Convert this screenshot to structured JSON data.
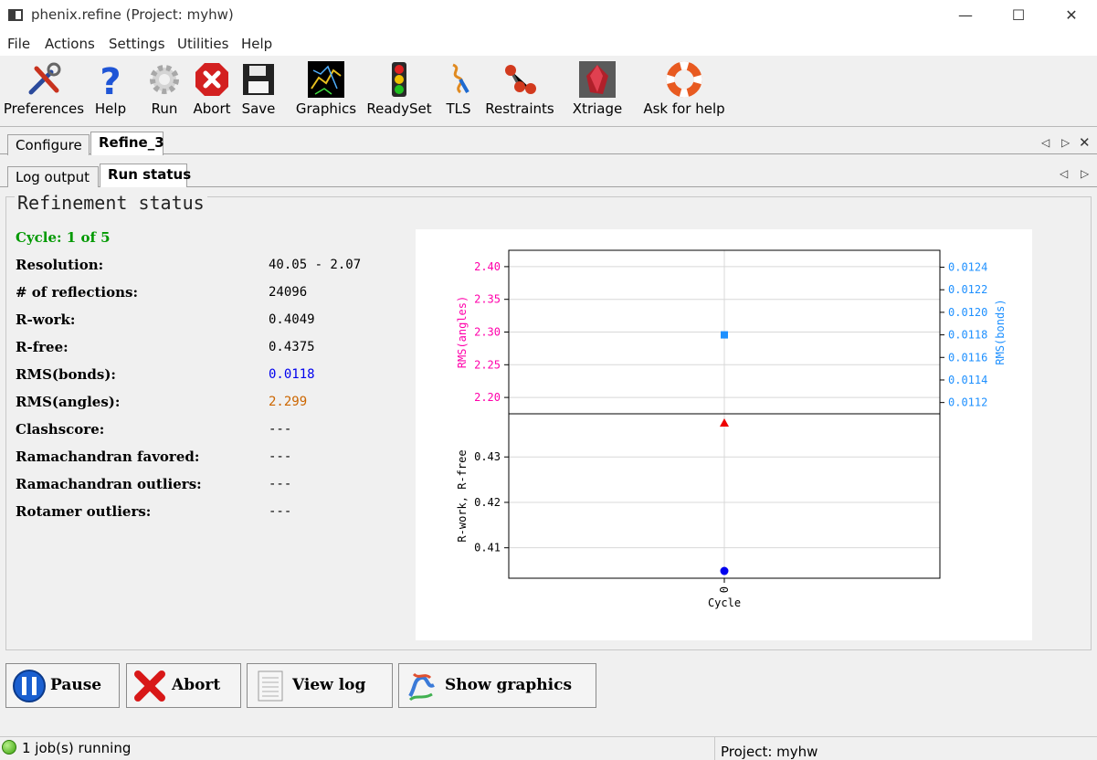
{
  "window": {
    "title": "phenix.refine (Project: myhw)"
  },
  "menu": [
    "File",
    "Actions",
    "Settings",
    "Utilities",
    "Help"
  ],
  "toolbar": {
    "preferences": "Preferences",
    "help": "Help",
    "run": "Run",
    "abort": "Abort",
    "save": "Save",
    "graphics": "Graphics",
    "readyset": "ReadySet",
    "tls": "TLS",
    "restraints": "Restraints",
    "xtriage": "Xtriage",
    "ask_help": "Ask for help"
  },
  "tabs": {
    "configure": "Configure",
    "refine": "Refine_3"
  },
  "subtabs": {
    "log": "Log output",
    "run_status": "Run status"
  },
  "panel": {
    "title": "Refinement status",
    "cycle": "Cycle: 1 of 5",
    "rows": [
      {
        "label": "Resolution:",
        "value": "40.05 - 2.07"
      },
      {
        "label": "# of reflections:",
        "value": "24096"
      },
      {
        "label": "R-work:",
        "value": "0.4049"
      },
      {
        "label": "R-free:",
        "value": "0.4375"
      },
      {
        "label": "RMS(bonds):",
        "value": "0.0118"
      },
      {
        "label": "RMS(angles):",
        "value": "2.299"
      },
      {
        "label": "Clashscore:",
        "value": "---"
      },
      {
        "label": "Ramachandran favored:",
        "value": "---"
      },
      {
        "label": "Ramachandran outliers:",
        "value": "---"
      },
      {
        "label": "Rotamer outliers:",
        "value": "---"
      }
    ]
  },
  "colors": {
    "cycle": "#009900",
    "bonds": "#0000ee",
    "angles": "#cc6600",
    "angles_axis": "#ff00aa",
    "bonds_axis": "#1e90ff"
  },
  "chart_data": {
    "type": "scatter",
    "top": {
      "ylabel_left": "RMS(angles)",
      "ylabel_right": "RMS(bonds)",
      "left_ticks": [
        "2.20",
        "2.25",
        "2.30",
        "2.35",
        "2.40"
      ],
      "right_ticks": [
        "0.0112",
        "0.0114",
        "0.0116",
        "0.0118",
        "0.0120",
        "0.0122",
        "0.0124"
      ],
      "ylim_left": [
        2.175,
        2.425
      ],
      "ylim_right": [
        0.0111,
        0.01255
      ],
      "series": [
        {
          "name": "RMS(angles)",
          "x": [
            0
          ],
          "y": [
            2.299
          ],
          "axis": "left"
        },
        {
          "name": "RMS(bonds)",
          "x": [
            0
          ],
          "y": [
            0.0118
          ],
          "axis": "right"
        }
      ]
    },
    "bottom": {
      "ylabel": "R-work, R-free",
      "xlabel": "Cycle",
      "ticks": [
        "0.41",
        "0.42",
        "0.43"
      ],
      "x_ticks": [
        "0"
      ],
      "ylim": [
        0.4033,
        0.4395
      ],
      "series": [
        {
          "name": "R-work",
          "x": [
            0
          ],
          "y": [
            0.4049
          ]
        },
        {
          "name": "R-free",
          "x": [
            0
          ],
          "y": [
            0.4375
          ]
        }
      ]
    },
    "grid": true
  },
  "buttons": {
    "pause": "Pause",
    "abort": "Abort",
    "view_log": "View log",
    "show_graphics": "Show graphics"
  },
  "statusbar": {
    "jobs": "1 job(s) running",
    "project": "Project: myhw"
  }
}
